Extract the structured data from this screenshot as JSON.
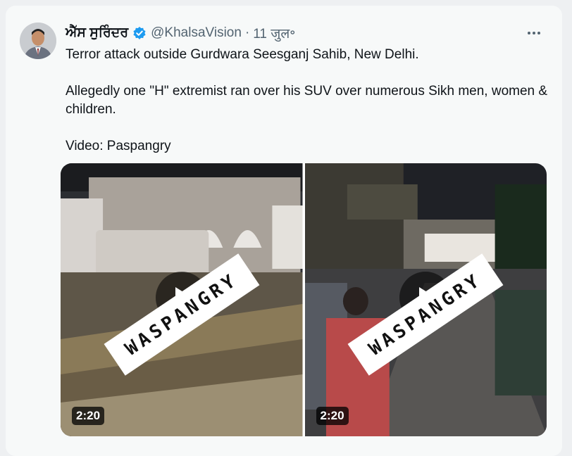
{
  "tweet": {
    "author_name": "ਐੱਸ ਸੁਰਿੰਦਰ",
    "handle": "@KhalsaVision",
    "separator": "·",
    "date": "11 जुल॰",
    "text_lines": [
      "Terror attack outside Gurdwara Seesganj Sahib, New Delhi.",
      "Allegedly one \"H\" extremist ran over his SUV over numerous Sikh men, women & children.",
      "Video: Paspangry"
    ]
  },
  "media": {
    "videos": [
      {
        "watermark": "WASPANGRY",
        "duration": "2:20"
      },
      {
        "watermark": "WASPANGRY",
        "duration": "2:20"
      }
    ]
  },
  "icons": {
    "verified": "verified-badge-icon",
    "more": "more-options-icon",
    "play": "play-icon"
  },
  "colors": {
    "accent": "#1d9bf0",
    "text": "#0f1419",
    "secondary": "#536471",
    "background": "#f7f9f9"
  }
}
